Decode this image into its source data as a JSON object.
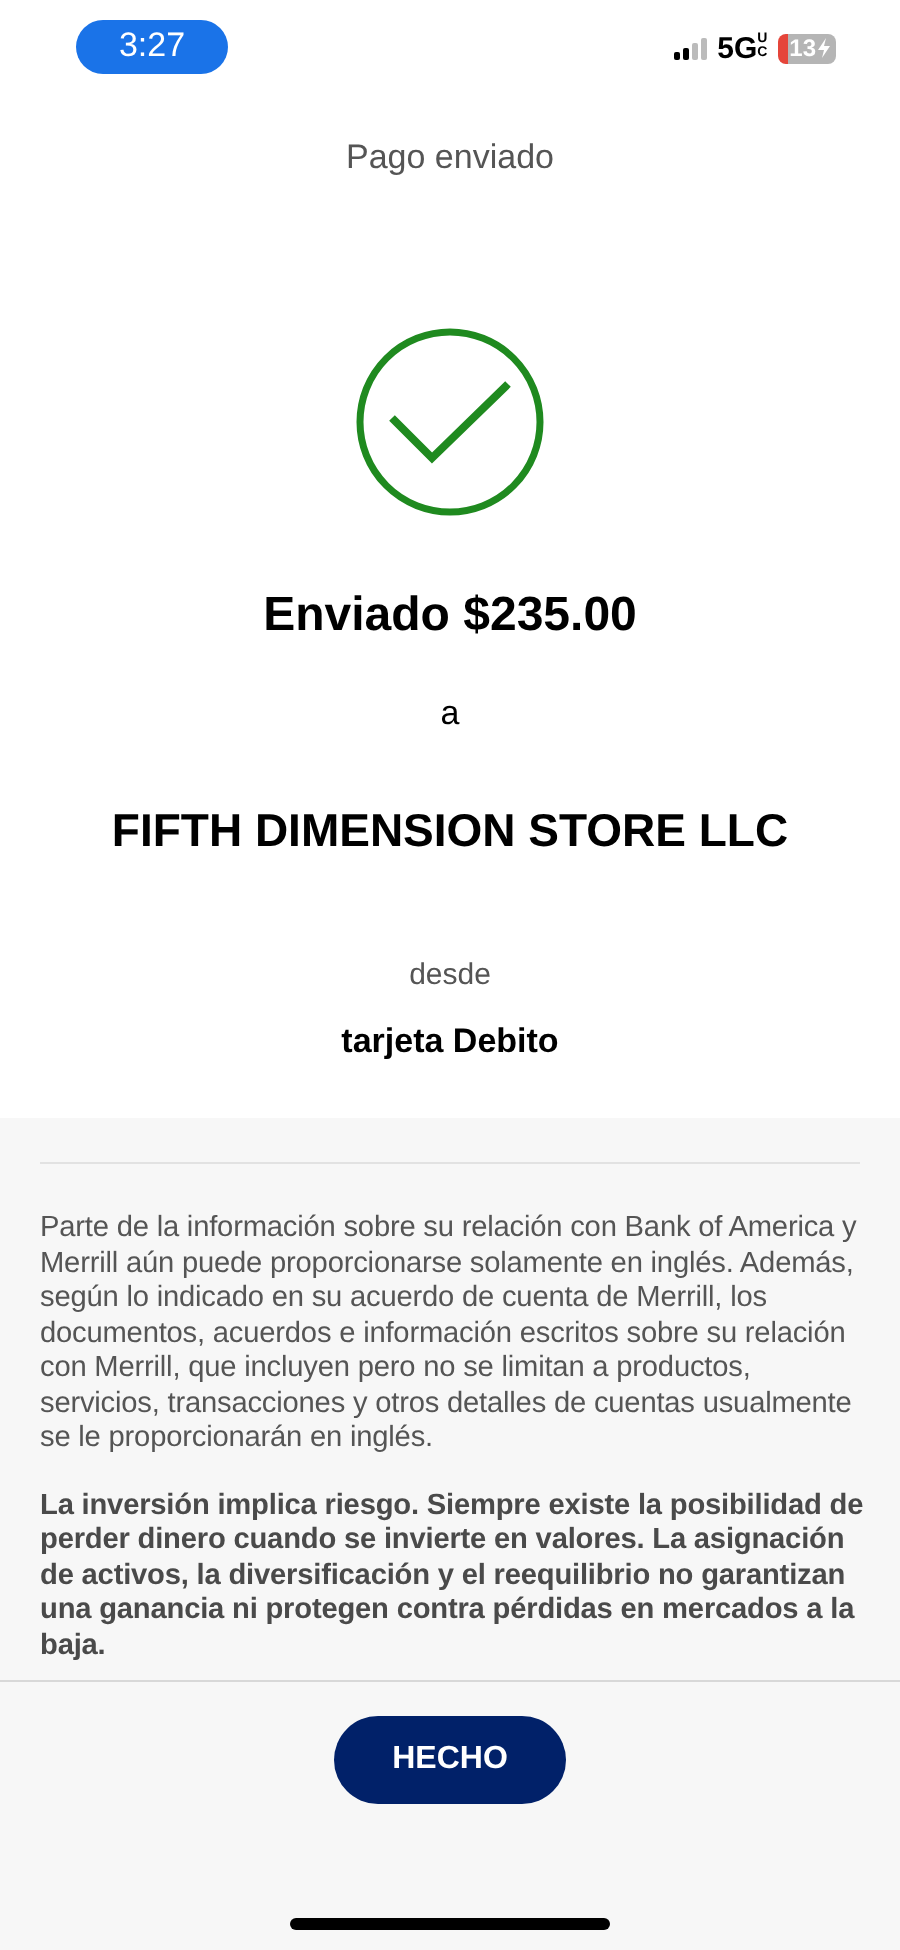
{
  "status_bar": {
    "time": "3:27",
    "network": "5G",
    "network_sub": "UC",
    "battery": "13",
    "charging": true
  },
  "header": {
    "title": "Pago enviado"
  },
  "confirmation": {
    "amount_line": "Enviado $235.00",
    "connector": "a",
    "recipient": "FIFTH DIMENSION STORE LLC",
    "from_label": "desde",
    "source": "tarjeta Debito"
  },
  "disclosures": [
    {
      "text": "Parte de la información sobre su relación con Bank of America y Merrill aún puede proporcionarse solamente en inglés. Además, según lo indicado en su acuerdo de cuenta de Merrill, los documentos, acuerdos e información escritos sobre su relación con Merrill, que incluyen pero no se limitan a productos, servicios, transacciones y otros detalles de cuentas usualmente se le proporcionarán en inglés.",
      "bold": false
    },
    {
      "text": "La inversión implica riesgo. Siempre existe la posibilidad de perder dinero cuando se invierte en valores. La asignación de activos, la diversificación y el reequilibrio no garantizan una ganancia ni protegen contra pérdidas en mercados a la baja.",
      "bold": true
    }
  ],
  "done_button": "HECHO"
}
